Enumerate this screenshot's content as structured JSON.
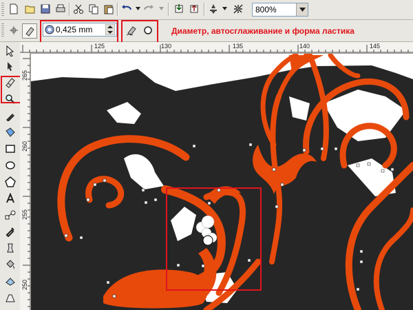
{
  "top_toolbar": {
    "buttons": [
      "new-document-icon",
      "open-icon",
      "save-icon",
      "print-icon",
      "cut-icon",
      "copy-icon",
      "paste-icon",
      "undo-icon",
      "redo-icon",
      "import-icon",
      "export-icon",
      "application-launcher-icon",
      "welcome-screen-icon"
    ],
    "zoom_level": "800%"
  },
  "property_bar": {
    "eraser_thickness": "0,425 mm",
    "auto_reduce": "auto-reduce-icon",
    "eraser_shape": "circle-shape-icon",
    "annotation": "Диаметр, автосглаживание и форма ластика"
  },
  "rulers": {
    "horizontal": [
      "125",
      "130",
      "135",
      "140",
      "145"
    ],
    "vertical": [
      "265",
      "260",
      "255",
      "250"
    ]
  },
  "toolbox": {
    "tools": [
      "pick-tool-icon",
      "shape-tool-icon",
      "eraser-tool-icon",
      "zoom-tool-icon",
      "freehand-tool-icon",
      "smart-fill-tool-icon",
      "rectangle-tool-icon",
      "ellipse-tool-icon",
      "polygon-tool-icon",
      "text-tool-icon",
      "interactive-blend-tool-icon",
      "eyedropper-tool-icon",
      "outline-tool-icon",
      "fill-tool-icon",
      "interactive-fill-tool-icon"
    ],
    "active_tool": "eraser-tool-icon"
  },
  "colors": {
    "accent_red": "#e0141c",
    "ornament_orange": "#e84a0c",
    "background_dark": "#262626",
    "page_white": "#ffffff"
  }
}
